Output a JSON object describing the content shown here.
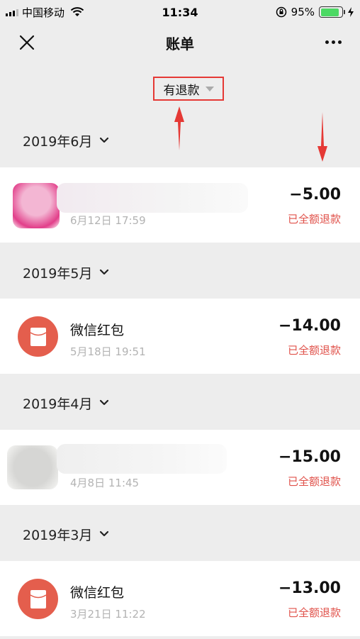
{
  "status_bar": {
    "carrier": "中国移动",
    "time": "11:34",
    "battery": "95%",
    "battery_color": "#4cd964"
  },
  "navbar": {
    "title": "账单",
    "close_icon": "close-icon",
    "more_icon": "more-dots-icon"
  },
  "filter": {
    "label": "有退款",
    "highlight_color": "#e53935"
  },
  "annotations": {
    "arrow_color": "#e53935"
  },
  "months": [
    {
      "label": "2019年6月"
    },
    {
      "label": "2019年5月"
    },
    {
      "label": "2019年4月"
    },
    {
      "label": "2019年3月"
    }
  ],
  "transactions": [
    {
      "name": "",
      "time": "6月12日 17:59",
      "amount": "−5.00",
      "status": "已全额退款",
      "icon": "blurred-avatar"
    },
    {
      "name": "微信红包",
      "time": "5月18日 19:51",
      "amount": "−14.00",
      "status": "已全额退款",
      "icon": "red-packet-icon"
    },
    {
      "name": "",
      "time": "4月8日 11:45",
      "amount": "−15.00",
      "status": "已全额退款",
      "icon": "blurred-avatar"
    },
    {
      "name": "微信红包",
      "time": "3月21日 11:22",
      "amount": "−13.00",
      "status": "已全额退款",
      "icon": "red-packet-icon"
    }
  ],
  "colors": {
    "refund_text": "#e0514a",
    "red_packet_bg": "#e45e4d",
    "page_bg": "#ededed"
  }
}
